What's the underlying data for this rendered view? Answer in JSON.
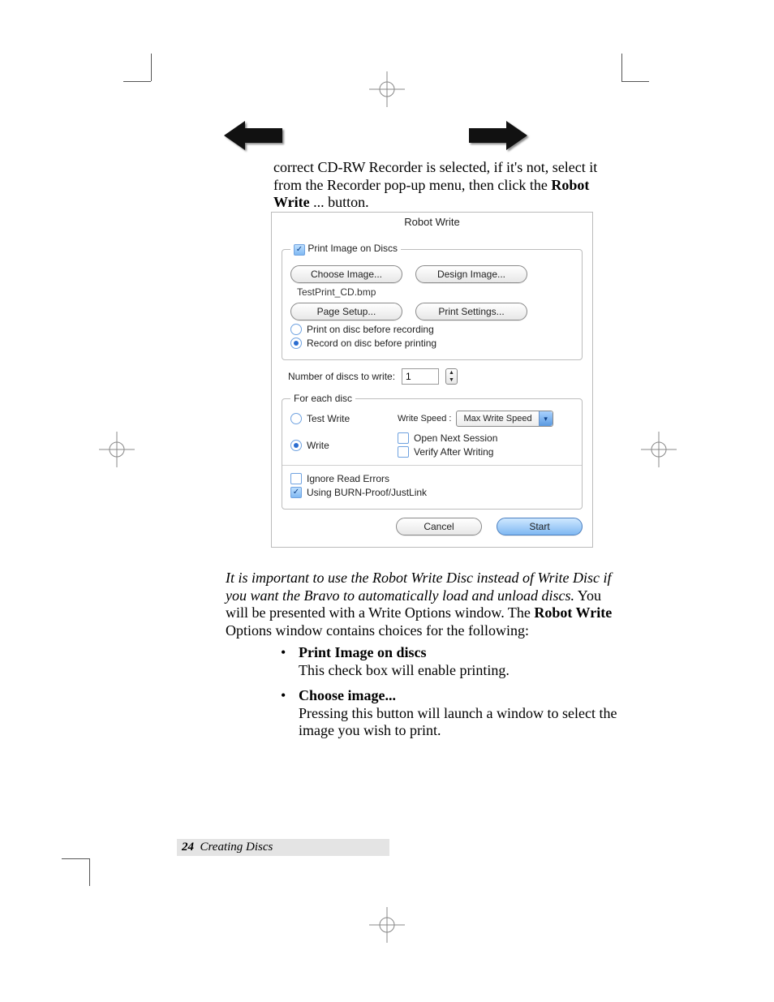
{
  "intro": {
    "pre": "correct CD-RW Recorder is selected, if it's not, select it from the Recorder pop-up menu, then click the ",
    "bold": "Robot Write",
    "post": " ... button."
  },
  "dialog": {
    "title": "Robot Write",
    "print_group": {
      "legend": "Print Image on Discs",
      "print_image_checked": true,
      "choose_image": "Choose Image...",
      "design_image": "Design Image...",
      "filename": "TestPrint_CD.bmp",
      "page_setup": "Page Setup...",
      "print_settings": "Print Settings...",
      "radio_print_first": "Print on disc before recording",
      "radio_record_first": "Record on disc before printing"
    },
    "num_label": "Number of discs to write:",
    "num_value": "1",
    "each_disc": {
      "legend": "For each disc",
      "radio_test": "Test Write",
      "radio_write": "Write",
      "write_speed_label": "Write Speed :",
      "write_speed_value": "Max Write Speed",
      "open_next": "Open Next Session",
      "verify_after": "Verify After Writing",
      "ignore_errors": "Ignore Read Errors",
      "burn_proof": "Using BURN-Proof/JustLink"
    },
    "cancel": "Cancel",
    "start": "Start"
  },
  "note": {
    "ital": "It is important to use the Robot Write Disc instead of Write Disc if you want the Bravo to automatically load and unload discs.",
    "rest1": " You will be presented with a Write Options window. The ",
    "bold": "Robot Write",
    "rest2": " Options window contains choices for the following:"
  },
  "opts": [
    {
      "title": "Print Image on discs",
      "body": "This check box will enable printing."
    },
    {
      "title": "Choose image...",
      "body": "Pressing this button will launch a window to select the image you wish to print."
    }
  ],
  "footer": {
    "page": "24",
    "section": "Creating Discs"
  }
}
